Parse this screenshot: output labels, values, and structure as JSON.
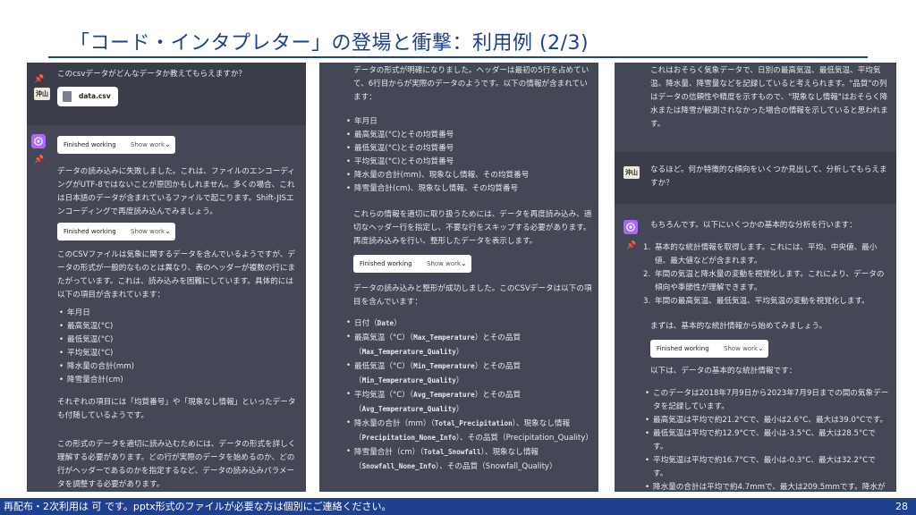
{
  "slide": {
    "title": "「コード・インタプレター」の登場と衝撃：利用例 (2/3)",
    "footer_text": "再配布・2次利用は 可 です。pptx形式のファイルが必要な方は個別にご連絡ください。",
    "page_number": "28"
  },
  "chat": {
    "user_avatar_label": "沖山",
    "finished_working_label": "Finished working",
    "show_work_label": "Show work"
  },
  "panel1": {
    "user_message": "このcsvデータがどんなデータか教えてもらえますか？",
    "file_name": "data.csv",
    "para1": "データの読み込みに失敗しました。これは、ファイルのエンコーディングがUTF-8ではないことが原因かもしれません。多くの場合、これは日本語のデータが含まれているファイルで起こります。Shift-JISエンコーディングで再度読み込んでみましょう。",
    "para2": "このCSVファイルは気象に関するデータを含んでいるようですが、データの形式が一般的なものとは異なり、表のヘッダーが複数の行にまたがっています。これは、読み込みを困難にしています。具体的には以下の項目が含まれています：",
    "items": [
      "年月日",
      "最高気温(°C)",
      "最低気温(°C)",
      "平均気温(°C)",
      "降水量の合計(mm)",
      "降雪量合計(cm)"
    ],
    "para3": "それぞれの項目には「均質番号」や「現象なし情報」といったデータも付随しているようです。",
    "para4": "この形式のデータを適切に読み込むためには、データの形式を詳しく理解する必要があります。どの行が実際のデータを始めるのか、どの行がヘッダーであるのかを指定するなど、データの読み込みパラメータを調整する必要があります。"
  },
  "panel2": {
    "para1": "データの形式が明確になりました。ヘッダーは最初の5行を占めていて、6行目からが実際のデータのようです。以下の情報が含まれています：",
    "items1": [
      "年月日",
      "最高気温(°C)とその均質番号",
      "最低気温(°C)とその均質番号",
      "平均気温(°C)とその均質番号",
      "降水量の合計(mm)、現象なし情報、その均質番号",
      "降雪量合計(cm)、現象なし情報、その均質番号"
    ],
    "para2": "これらの情報を適切に取り扱うためには、データを再度読み込み、適切なヘッダー行を指定し、不要な行をスキップする必要があります。再度読み込みを行い、整形したデータを表示します。",
    "para3": "データの読み込みと整形が成功しました。このCSVデータは以下の項目を含んでいます：",
    "items2": [
      {
        "pre": "日付（",
        "c1": "Date",
        "mid": "）",
        "c2": "",
        "post": ""
      },
      {
        "pre": "最高気温（°C）（",
        "c1": "Max_Temperature",
        "mid": "）とその品質（",
        "c2": "Max_Temperature_Quality",
        "post": "）"
      },
      {
        "pre": "最低気温（°C）（",
        "c1": "Min_Temperature",
        "mid": "）とその品質（",
        "c2": "Min_Temperature_Quality",
        "post": "）"
      },
      {
        "pre": "平均気温（°C）（",
        "c1": "Avg_Temperature",
        "mid": "）とその品質（",
        "c2": "Avg_Temperature_Quality",
        "post": "）"
      },
      {
        "pre": "降水量の合計（mm）（",
        "c1": "Total_Precipitation",
        "mid": "）、現象なし情報（",
        "c2": "Precipitation_None_Info",
        "post": "）、その品質（Precipitation_Quality）"
      },
      {
        "pre": "降雪量合計（cm）（",
        "c1": "Total_Snowfall",
        "mid": "）、現象なし情報（",
        "c2": "Snowfall_None_Info",
        "post": "）、その品質（Snowfall_Quality）"
      }
    ]
  },
  "panel3": {
    "para1": "これはおそらく気象データで、日別の最高気温、最低気温、平均気温、降水量、降雪量などを記録していると考えられます。\"品質\"の列はデータの信頼性や精度を示すもので、\"現象なし情報\"はおそらく降水または降雪が観測されなかった場合の情報を示していると思われます。",
    "user_message": "なるほど。何か特徴的な傾向をいくつか見出して、分析してもらえますか？",
    "para2": "もちろんです。以下にいくつかの基本的な分析を行います：",
    "steps": [
      "基本的な統計情報を取得します。これには、平均、中央値、最小値、最大値などが含まれます。",
      "年間の気温と降水量の変動を視覚化します。これにより、データの傾向や季節性が理解できます。",
      "年間の最高気温、最低気温、平均気温の変動を視覚化します。"
    ],
    "para3": "まずは、基本的な統計情報から始めてみましょう。",
    "para4": "以下は、データの基本的な統計情報です：",
    "stats": [
      "このデータは2018年7月9日から2023年7月9日までの間の気象データを記録しています。",
      "最高気温は平均で約21.2°Cで、最小は2.6°C、最大は39.0°Cです。",
      "最低気温は平均で約12.9°Cで、最小は-3.5°C、最大は28.5°Cです。",
      "平均気温は平均で約16.7°Cで、最小は-0.3°C、最大は32.2°Cです。",
      "降水量の合計は平均で約4.7mmで、最大は209.5mmです。降水が観測されなかった日が多いことがわかります。"
    ]
  }
}
